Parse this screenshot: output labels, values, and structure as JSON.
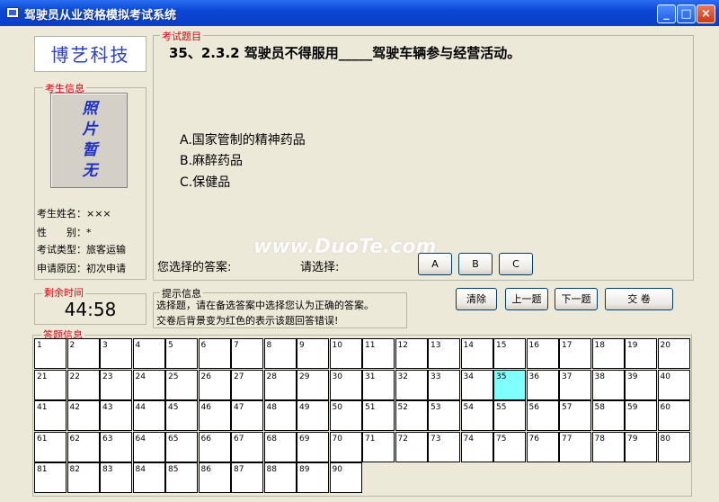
{
  "window": {
    "title": "驾驶员从业资格模拟考试系统",
    "min": "_",
    "max": "□",
    "close": "×"
  },
  "logo": "博艺科技",
  "candidate": {
    "legend": "考生信息",
    "photo_lines": [
      "照",
      "片",
      "暂",
      "无"
    ],
    "rows": [
      "考生姓名：×××",
      "性　　别：*",
      "考试类型：旅客运输",
      "申请原因：初次申请"
    ]
  },
  "timer": {
    "legend": "剩余时间",
    "value": "44:58"
  },
  "question": {
    "legend": "考试题目",
    "text": "35、2.3.2 驾驶员不得服用_____驾驶车辆参与经营活动。",
    "options": [
      "A.国家管制的精神药品",
      "B.麻醉药品",
      "C.保健品"
    ]
  },
  "answer": {
    "selected_label": "您选择的答案:",
    "choose_label": "请选择:",
    "choices": [
      "A",
      "B",
      "C"
    ]
  },
  "hint": {
    "legend": "提示信息",
    "lines": [
      "选择题，请在备选答案中选择您认为正确的答案。",
      "交卷后背景变为红色的表示该题回答错误!"
    ]
  },
  "actions": {
    "clear": "清除",
    "prev": "上一题",
    "next": "下一题",
    "submit": "交 卷"
  },
  "answer_grid": {
    "legend": "答题信息",
    "rows": [
      [
        "1",
        "2",
        "3",
        "4",
        "5",
        "6",
        "7",
        "8",
        "9",
        "10",
        "11",
        "12",
        "13",
        "14",
        "15",
        "16",
        "17",
        "18",
        "19",
        "20"
      ],
      [
        "21",
        "22",
        "23",
        "24",
        "25",
        "26",
        "27",
        "28",
        "29",
        "30",
        "31",
        "32",
        "33",
        "34",
        "35",
        "36",
        "37",
        "38",
        "39",
        "40"
      ],
      [
        "41",
        "42",
        "43",
        "44",
        "45",
        "46",
        "47",
        "48",
        "49",
        "50",
        "51",
        "52",
        "53",
        "54",
        "55",
        "56",
        "57",
        "58",
        "59",
        "60"
      ],
      [
        "61",
        "62",
        "63",
        "64",
        "65",
        "66",
        "67",
        "68",
        "69",
        "70",
        "71",
        "72",
        "73",
        "74",
        "75",
        "76",
        "77",
        "78",
        "79",
        "80"
      ],
      [
        "81",
        "82",
        "83",
        "84",
        "85",
        "86",
        "87",
        "88",
        "89",
        "90"
      ]
    ],
    "current": "35"
  },
  "watermark": "www.DuoTe.com"
}
